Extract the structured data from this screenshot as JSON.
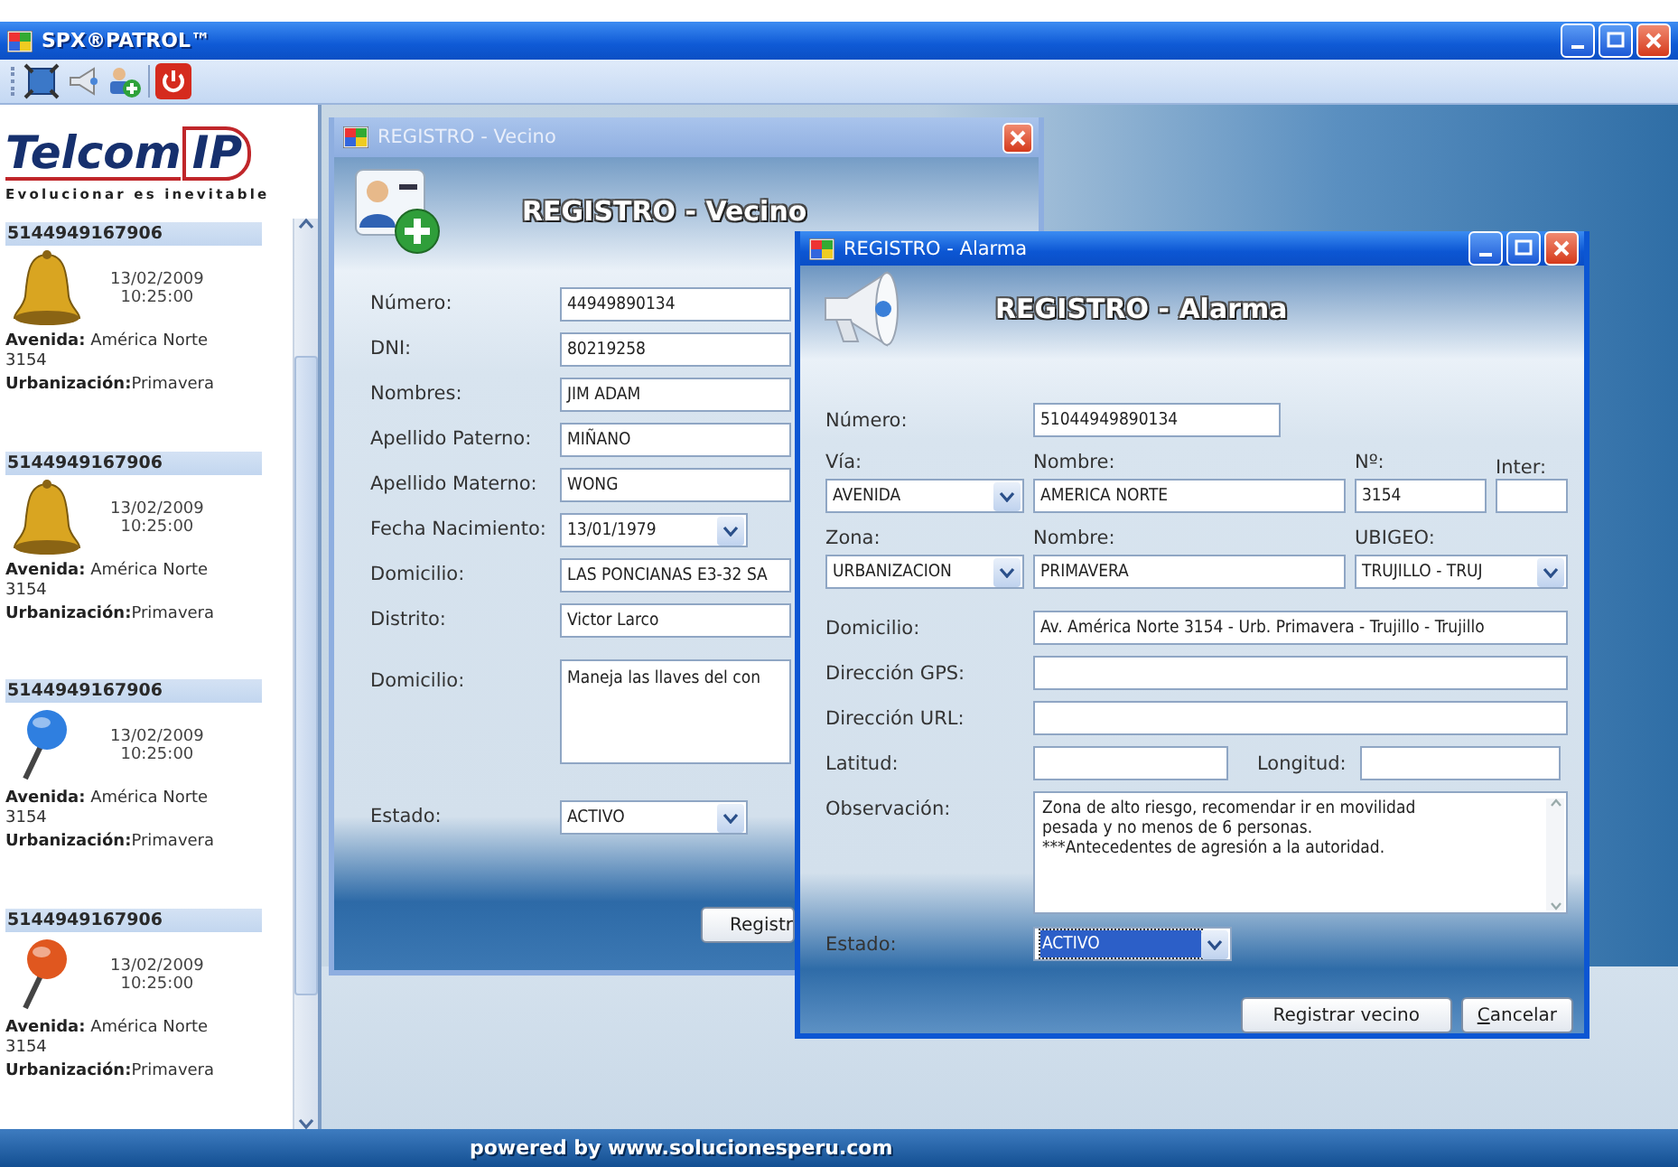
{
  "app": {
    "title": "SPX®PATROL™",
    "footer": "powered by www.solucionesperu.com"
  },
  "sidebar": {
    "logo": {
      "name": "Telcom",
      "suffix": "IP",
      "slogan": "Evolucionar es inevitable"
    },
    "alerts": [
      {
        "number": "5144949167906",
        "kind": "bell",
        "color": "#d9a521",
        "date": "13/02/2009",
        "time": "10:25:00",
        "address": "**Avenida:** América Norte 3154",
        "zone": "**Urbanización:**Primavera"
      },
      {
        "number": "5144949167906",
        "kind": "bell",
        "color": "#d9a521",
        "date": "13/02/2009",
        "time": "10:25:00",
        "address": "**Avenida:** América Norte 3154",
        "zone": "**Urbanización:**Primavera"
      },
      {
        "number": "5144949167906",
        "kind": "pin",
        "color": "#2f7fe0",
        "date": "13/02/2009",
        "time": "10:25:00",
        "address": "**Avenida:** América Norte 3154",
        "zone": "**Urbanización:**Primavera"
      },
      {
        "number": "5144949167906",
        "kind": "pin",
        "color": "#e0571f",
        "date": "13/02/2009",
        "time": "10:25:00",
        "address": "**Avenida:** América Norte 3154",
        "zone": "**Urbanización:**Primavera"
      }
    ]
  },
  "vecino": {
    "title": "REGISTRO - Vecino",
    "active": false,
    "heading": "REGISTRO - Vecino",
    "fields": [
      {
        "label": "Número:",
        "value": "44949890134",
        "kind": "text"
      },
      {
        "label": "DNI:",
        "value": "80219258",
        "kind": "text"
      },
      {
        "label": "Nombres:",
        "value": "JIM ADAM",
        "kind": "text"
      },
      {
        "label": "Apellido Paterno:",
        "value": "MIÑANO",
        "kind": "text"
      },
      {
        "label": "Apellido Materno:",
        "value": "WONG",
        "kind": "text"
      },
      {
        "label": "Fecha Nacimiento:",
        "value": "13/01/1979",
        "kind": "select"
      },
      {
        "label": "Domicilio:",
        "value": "LAS PONCIANAS E3-32 SA",
        "kind": "text"
      },
      {
        "label": "Distrito:",
        "value": "Victor Larco",
        "kind": "text"
      },
      {
        "label": "Domicilio:",
        "value": "Maneja las llaves del con",
        "kind": "textarea"
      },
      {
        "label": "Estado:",
        "value": "ACTIVO",
        "kind": "select"
      }
    ],
    "button": "Registr"
  },
  "alarma": {
    "title": "REGISTRO - Alarma",
    "active": true,
    "heading": "REGISTRO - Alarma",
    "numero": {
      "label": "Número:",
      "value": "51044949890134"
    },
    "via": {
      "label": "Vía:",
      "value": "AVENIDA"
    },
    "via_nombre": {
      "label": "Nombre:",
      "value": "AMERICA NORTE"
    },
    "numero_via": {
      "label": "Nº:",
      "value": "3154"
    },
    "inter": {
      "label": "Inter:"
    },
    "zona": {
      "label": "Zona:",
      "value": "URBANIZACION"
    },
    "zona_nombre": {
      "label": "Nombre:",
      "value": "PRIMAVERA"
    },
    "ubigeo": {
      "label": "UBIGEO:",
      "value": "TRUJILLO - TRUJ"
    },
    "domicilio": {
      "label": "Domicilio:",
      "value": "Av. América Norte 3154 - Urb. Primavera - Trujillo - Trujillo"
    },
    "gps": {
      "label": "Dirección GPS:"
    },
    "url": {
      "label": "Dirección URL:"
    },
    "latitud": {
      "label": "Latitud:"
    },
    "longitud": {
      "label": "Longitud:"
    },
    "observacion": {
      "label": "Observación:",
      "value": "Zona de alto riesgo, recomendar ir en movilidad\npesada y no menos de 6 personas.\n***Antecedentes de agresión a la autoridad."
    },
    "estado": {
      "label": "Estado:",
      "value": "ACTIVO",
      "focused": true
    },
    "buttons": [
      {
        "label": "Registrar vecino"
      },
      {
        "label": "Cancelar"
      }
    ]
  }
}
